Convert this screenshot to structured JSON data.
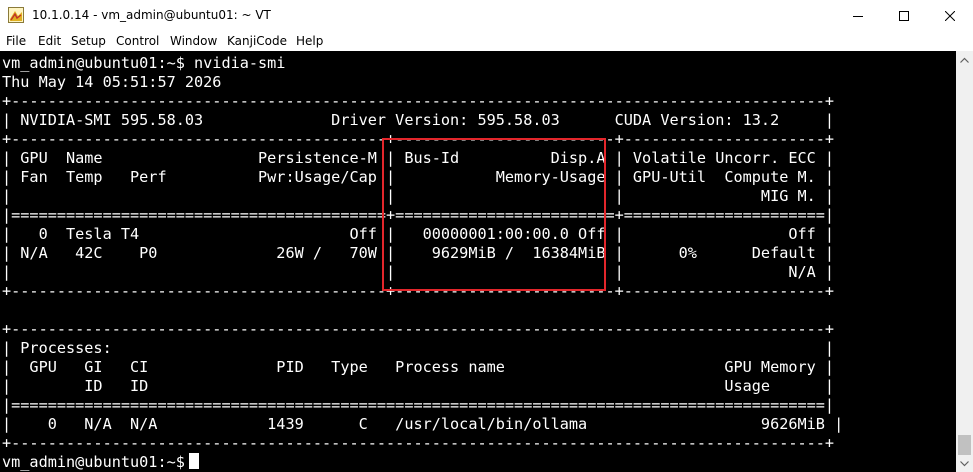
{
  "window": {
    "title": "10.1.0.14 - vm_admin@ubuntu01: ~ VT"
  },
  "menu": [
    "File",
    "Edit",
    "Setup",
    "Control",
    "Window",
    "KanjiCode",
    "Help"
  ],
  "terminal": {
    "lines": [
      "vm_admin@ubuntu01:~$ nvidia-smi",
      "Thu May 14 05:51:57 2026",
      "+-----------------------------------------------------------------------------------------+",
      "| NVIDIA-SMI 595.58.03              Driver Version: 595.58.03      CUDA Version: 13.2     |",
      "+-----------------------------------------+------------------------+----------------------+",
      "| GPU  Name                 Persistence-M | Bus-Id          Disp.A | Volatile Uncorr. ECC |",
      "| Fan  Temp   Perf          Pwr:Usage/Cap |           Memory-Usage | GPU-Util  Compute M. |",
      "|                                         |                        |               MIG M. |",
      "|=========================================+========================+======================|",
      "|   0  Tesla T4                       Off |   00000001:00:00.0 Off |                  Off |",
      "| N/A   42C    P0             26W /   70W |    9629MiB /  16384MiB |      0%      Default |",
      "|                                         |                        |                  N/A |",
      "+-----------------------------------------+------------------------+----------------------+",
      "",
      "+-----------------------------------------------------------------------------------------+",
      "| Processes:                                                                              |",
      "|  GPU   GI   CI              PID   Type   Process name                        GPU Memory |",
      "|        ID   ID                                                               Usage      |",
      "|=========================================================================================|",
      "|    0   N/A  N/A            1439      C   /usr/local/bin/ollama                   9626MiB |",
      "+-----------------------------------------------------------------------------------------+",
      "vm_admin@ubuntu01:~$ "
    ]
  },
  "colors": {
    "terminal_bg": "#000000",
    "terminal_fg": "#ffffff",
    "highlight_border": "#e3262b"
  },
  "icons": {
    "app": "teraterm-app-icon",
    "minimize": "minimize-icon",
    "maximize": "maximize-icon",
    "close": "close-icon"
  }
}
